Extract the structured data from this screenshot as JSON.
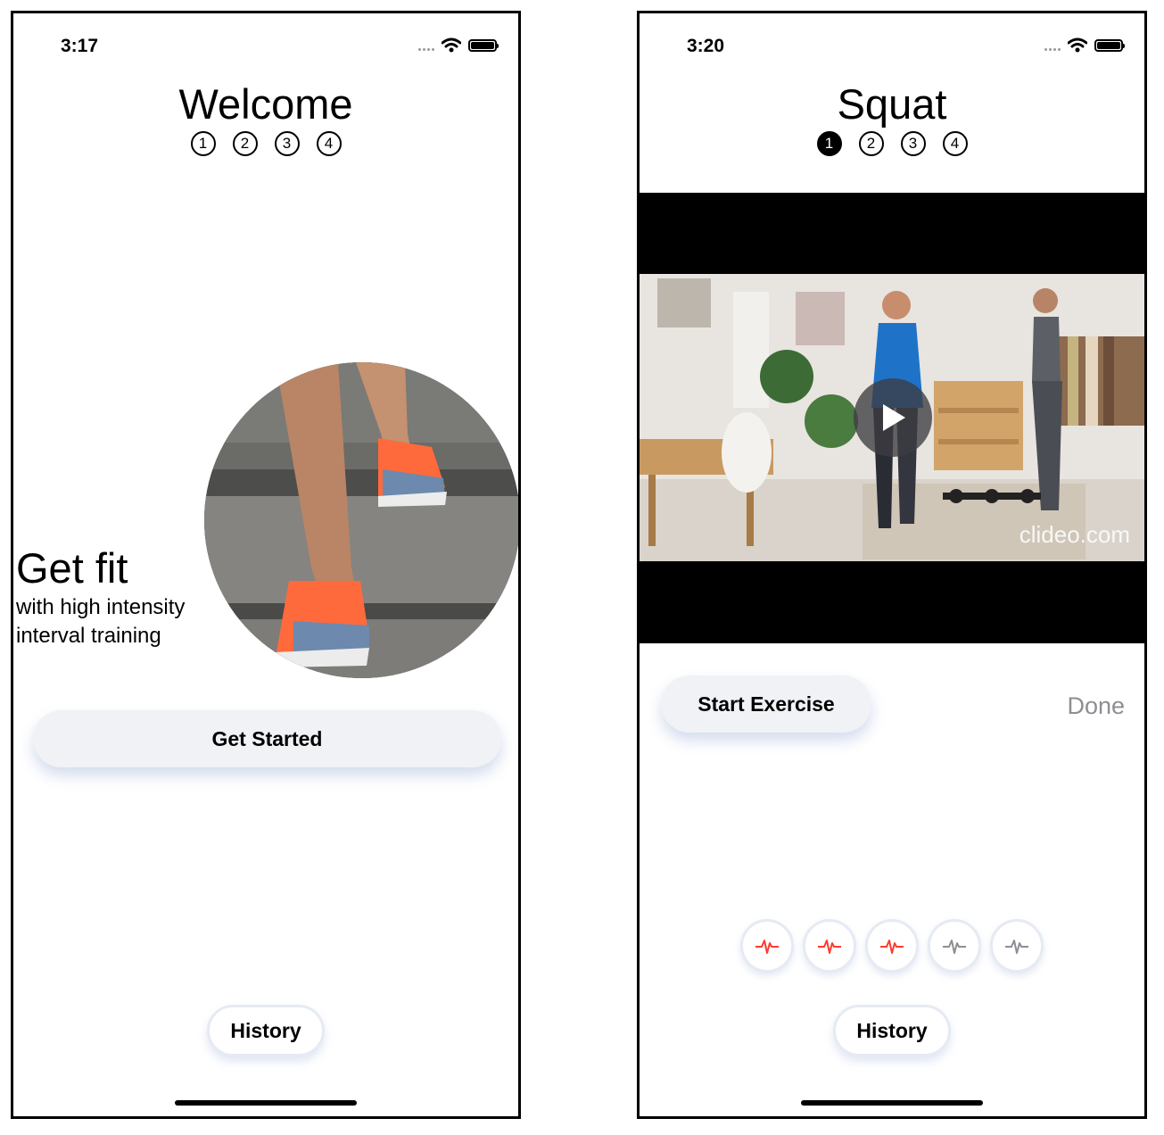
{
  "left": {
    "status_time": "3:17",
    "title": "Welcome",
    "steps": [
      "1",
      "2",
      "3",
      "4"
    ],
    "headline": "Get fit",
    "subline": "with high intensity interval training",
    "primary_button": "Get Started",
    "history_button": "History"
  },
  "right": {
    "status_time": "3:20",
    "title": "Squat",
    "steps": [
      "1",
      "2",
      "3",
      "4"
    ],
    "active_step": 1,
    "video": {
      "watermark": "clideo.com",
      "play_icon": "play-icon"
    },
    "primary_button": "Start Exercise",
    "done_label": "Done",
    "heart_rate_indicators": [
      {
        "icon": "heartbeat-icon",
        "active": true
      },
      {
        "icon": "heartbeat-icon",
        "active": true
      },
      {
        "icon": "heartbeat-icon",
        "active": true
      },
      {
        "icon": "heartbeat-icon",
        "active": false
      },
      {
        "icon": "heartbeat-icon",
        "active": false
      }
    ],
    "history_button": "History"
  },
  "colors": {
    "active_heartbeat": "#ff3b30",
    "inactive_heartbeat": "#8e8e93",
    "button_bg": "#f0f2f6",
    "done_gray": "#8e8e93"
  }
}
